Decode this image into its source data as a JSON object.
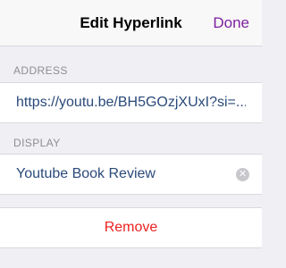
{
  "navbar": {
    "title": "Edit Hyperlink",
    "done_label": "Done"
  },
  "address": {
    "header": "ADDRESS",
    "value": "https://youtu.be/BH5GOzjXUxI?si=..."
  },
  "display": {
    "header": "DISPLAY",
    "value": "Youtube Book Review",
    "clear_icon": "clear-circle-icon"
  },
  "remove": {
    "label": "Remove"
  },
  "colors": {
    "accent": "#7e1fa0",
    "destructive": "#ec2120",
    "link_text": "#2a4a7a",
    "background": "#efeff4",
    "secondary_text": "#8e8e93"
  }
}
